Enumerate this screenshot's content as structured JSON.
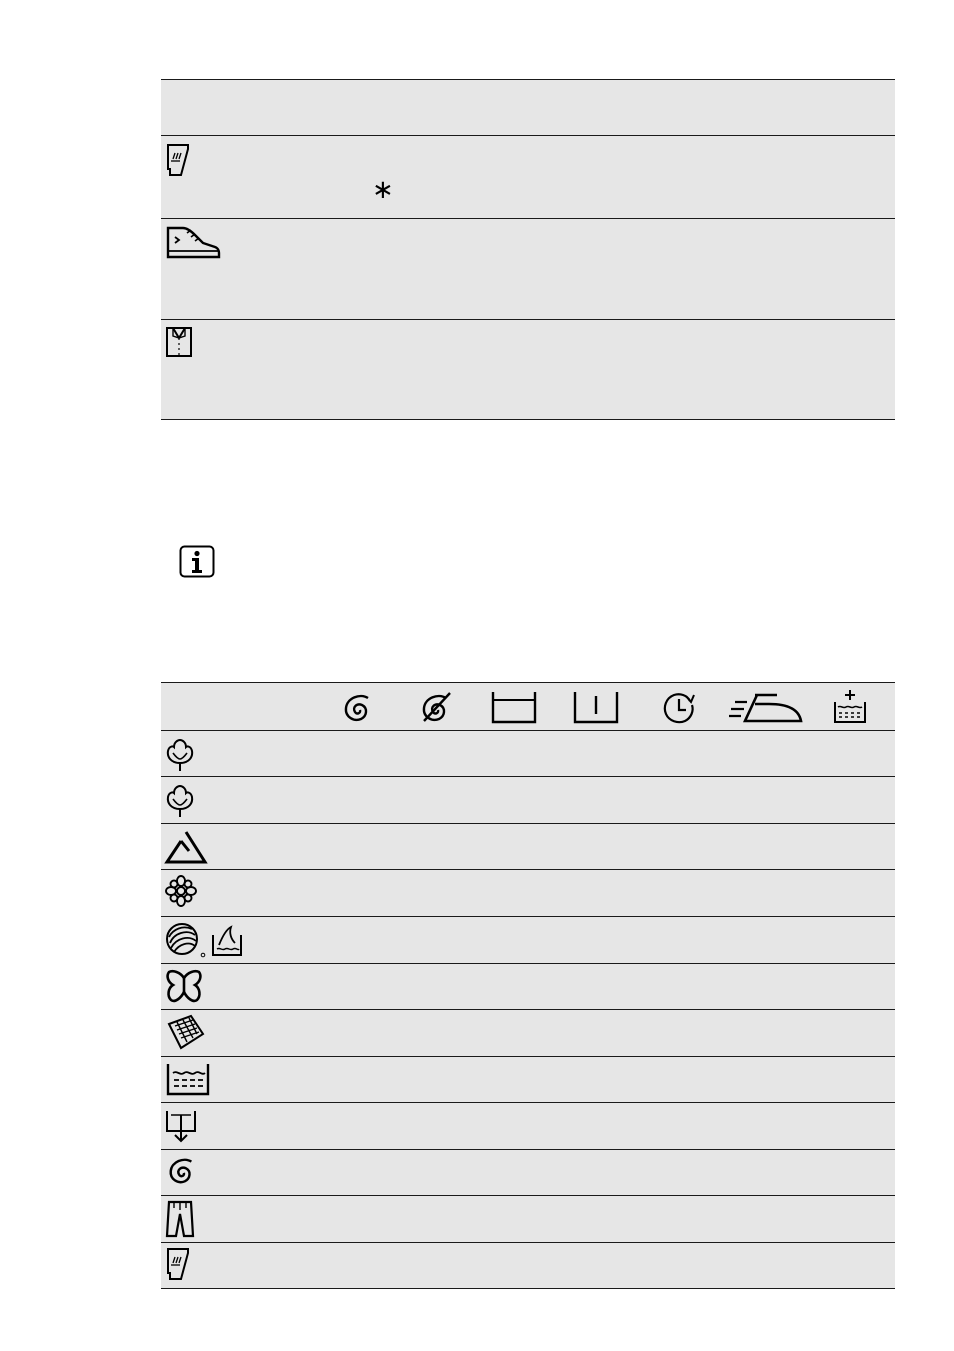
{
  "top_table": {
    "rows": [
      {
        "icon": "header-blank",
        "text": ""
      },
      {
        "icon": "jeans-pocket-icon",
        "text": ""
      },
      {
        "icon": "sneaker-icon",
        "text": ""
      },
      {
        "icon": "shirt-icon",
        "text": ""
      }
    ],
    "asterisk": "∗"
  },
  "info_icon": "info-icon",
  "option_table": {
    "column_icons": [
      "spin-icon",
      "no-spin-icon",
      "rinse-hold-icon",
      "night-cycle-icon",
      "time-manager-icon",
      "easy-iron-icon",
      "extra-rinse-icon"
    ],
    "programme_icons": [
      "cotton-icon",
      "cotton-eco-icon",
      "synthetics-icon",
      "delicates-icon",
      "wool-silk-icon",
      "duvet-icon",
      "outdoor-icon",
      "rinse-icon",
      "drain-icon",
      "spin-icon",
      "jeans-icon",
      "denim-icon"
    ]
  },
  "colors": {
    "row_bg": "#e6e6e6",
    "rule": "#1a1a1a"
  }
}
